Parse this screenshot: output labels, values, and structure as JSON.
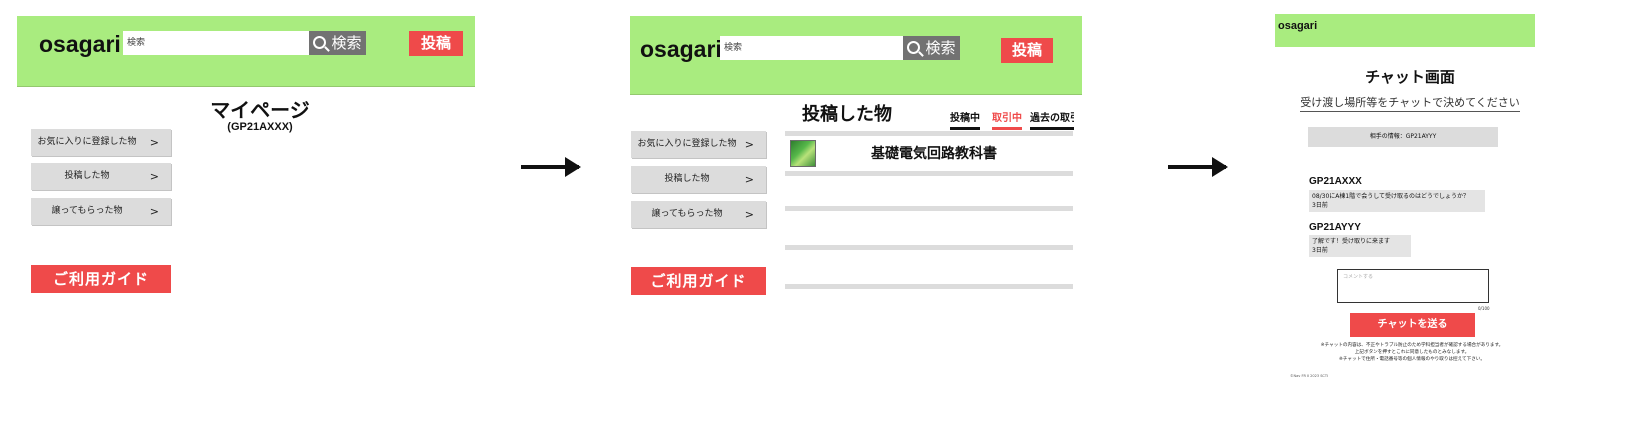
{
  "screen1": {
    "logo": "osagari",
    "search": {
      "value": "検索"
    },
    "search_button": "検索",
    "post_button": "投稿",
    "page_title": "マイページ",
    "user_id": "(GP21AXXX)",
    "sidebar": {
      "items": [
        {
          "label": "お気に入りに登録した物",
          "chevron": ">"
        },
        {
          "label": "投稿した物",
          "chevron": ">"
        },
        {
          "label": "譲ってもらった物",
          "chevron": ">"
        }
      ]
    },
    "guide_button": "ご利用ガイド"
  },
  "screen2": {
    "logo": "osagari",
    "search": {
      "value": "検索"
    },
    "search_button": "検索",
    "post_button": "投稿",
    "title": "投稿した物",
    "tabs": [
      {
        "label": "投稿中",
        "color": "#111111"
      },
      {
        "label": "取引中",
        "color": "#ef4a4a"
      },
      {
        "label": "過去の取引",
        "color": "#111111"
      }
    ],
    "sidebar": {
      "items": [
        {
          "label": "お気に入りに登録した物",
          "chevron": ">"
        },
        {
          "label": "投稿した物",
          "chevron": ">"
        },
        {
          "label": "譲ってもらった物",
          "chevron": ">"
        }
      ]
    },
    "guide_button": "ご利用ガイド",
    "list": [
      {
        "title": "基礎電気回路教科書",
        "has_thumbnail": true
      }
    ]
  },
  "screen3": {
    "logo": "osagari",
    "title": "チャット画面",
    "subtitle": "受け渡し場所等をチャットで決めてください",
    "partner_info": "相手の情報：GP21AYYY",
    "messages": [
      {
        "sender": "GP21AXXX",
        "text": "08/30にA棟1階で会うして受け取るのはどうでしょうか？",
        "time": "3日前"
      },
      {
        "sender": "GP21AYYY",
        "text": "了解です！受け取りに来ます",
        "time": "3日前"
      }
    ],
    "comment_placeholder": "コメントする",
    "char_count": "0/100",
    "send_button": "チャットを送る",
    "notices": [
      "※チャットの内容は、不正やトラブル防止のため学科担当者が確認する場合があります。",
      "上記ボタンを押すとこれに同意したものとみなします。",
      "※チャットで住所・電話番号等の個人情報のやり取りは控えて下さい。"
    ],
    "footer": "©Nav FR II 2023 SCTI"
  },
  "colors": {
    "header_green": "#a9ec7f",
    "accent_red": "#ef4a4a",
    "button_gray": "#dcdcdc",
    "search_gray": "#727272"
  },
  "icons": [
    "search-icon",
    "right-arrow-icon"
  ]
}
